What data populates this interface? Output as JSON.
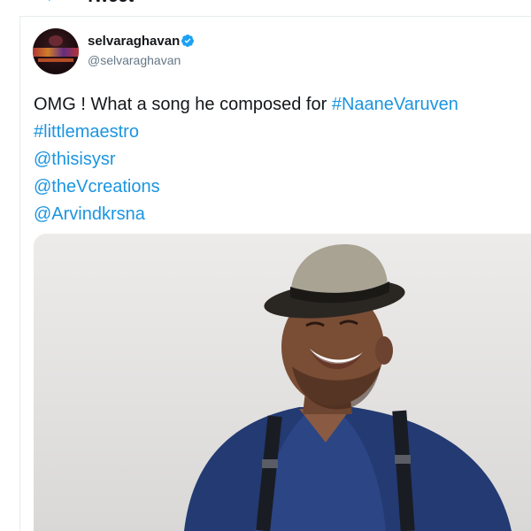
{
  "header": {
    "title": "Tweet"
  },
  "tweet": {
    "author": {
      "display_name": "selvaraghavan",
      "handle": "@selvaraghavan",
      "verified": true
    },
    "text_prefix": "OMG ! What a song he composed for ",
    "hashtag_1": "#NaaneVaruven",
    "hashtag_2": "#littlemaestro",
    "mention_1": "@thisisysr",
    "mention_2": "@theVcreations",
    "mention_3": "@Arvindkrsna"
  },
  "colors": {
    "link": "#1b95e0",
    "verified": "#1da1f2",
    "handle": "#657786"
  }
}
